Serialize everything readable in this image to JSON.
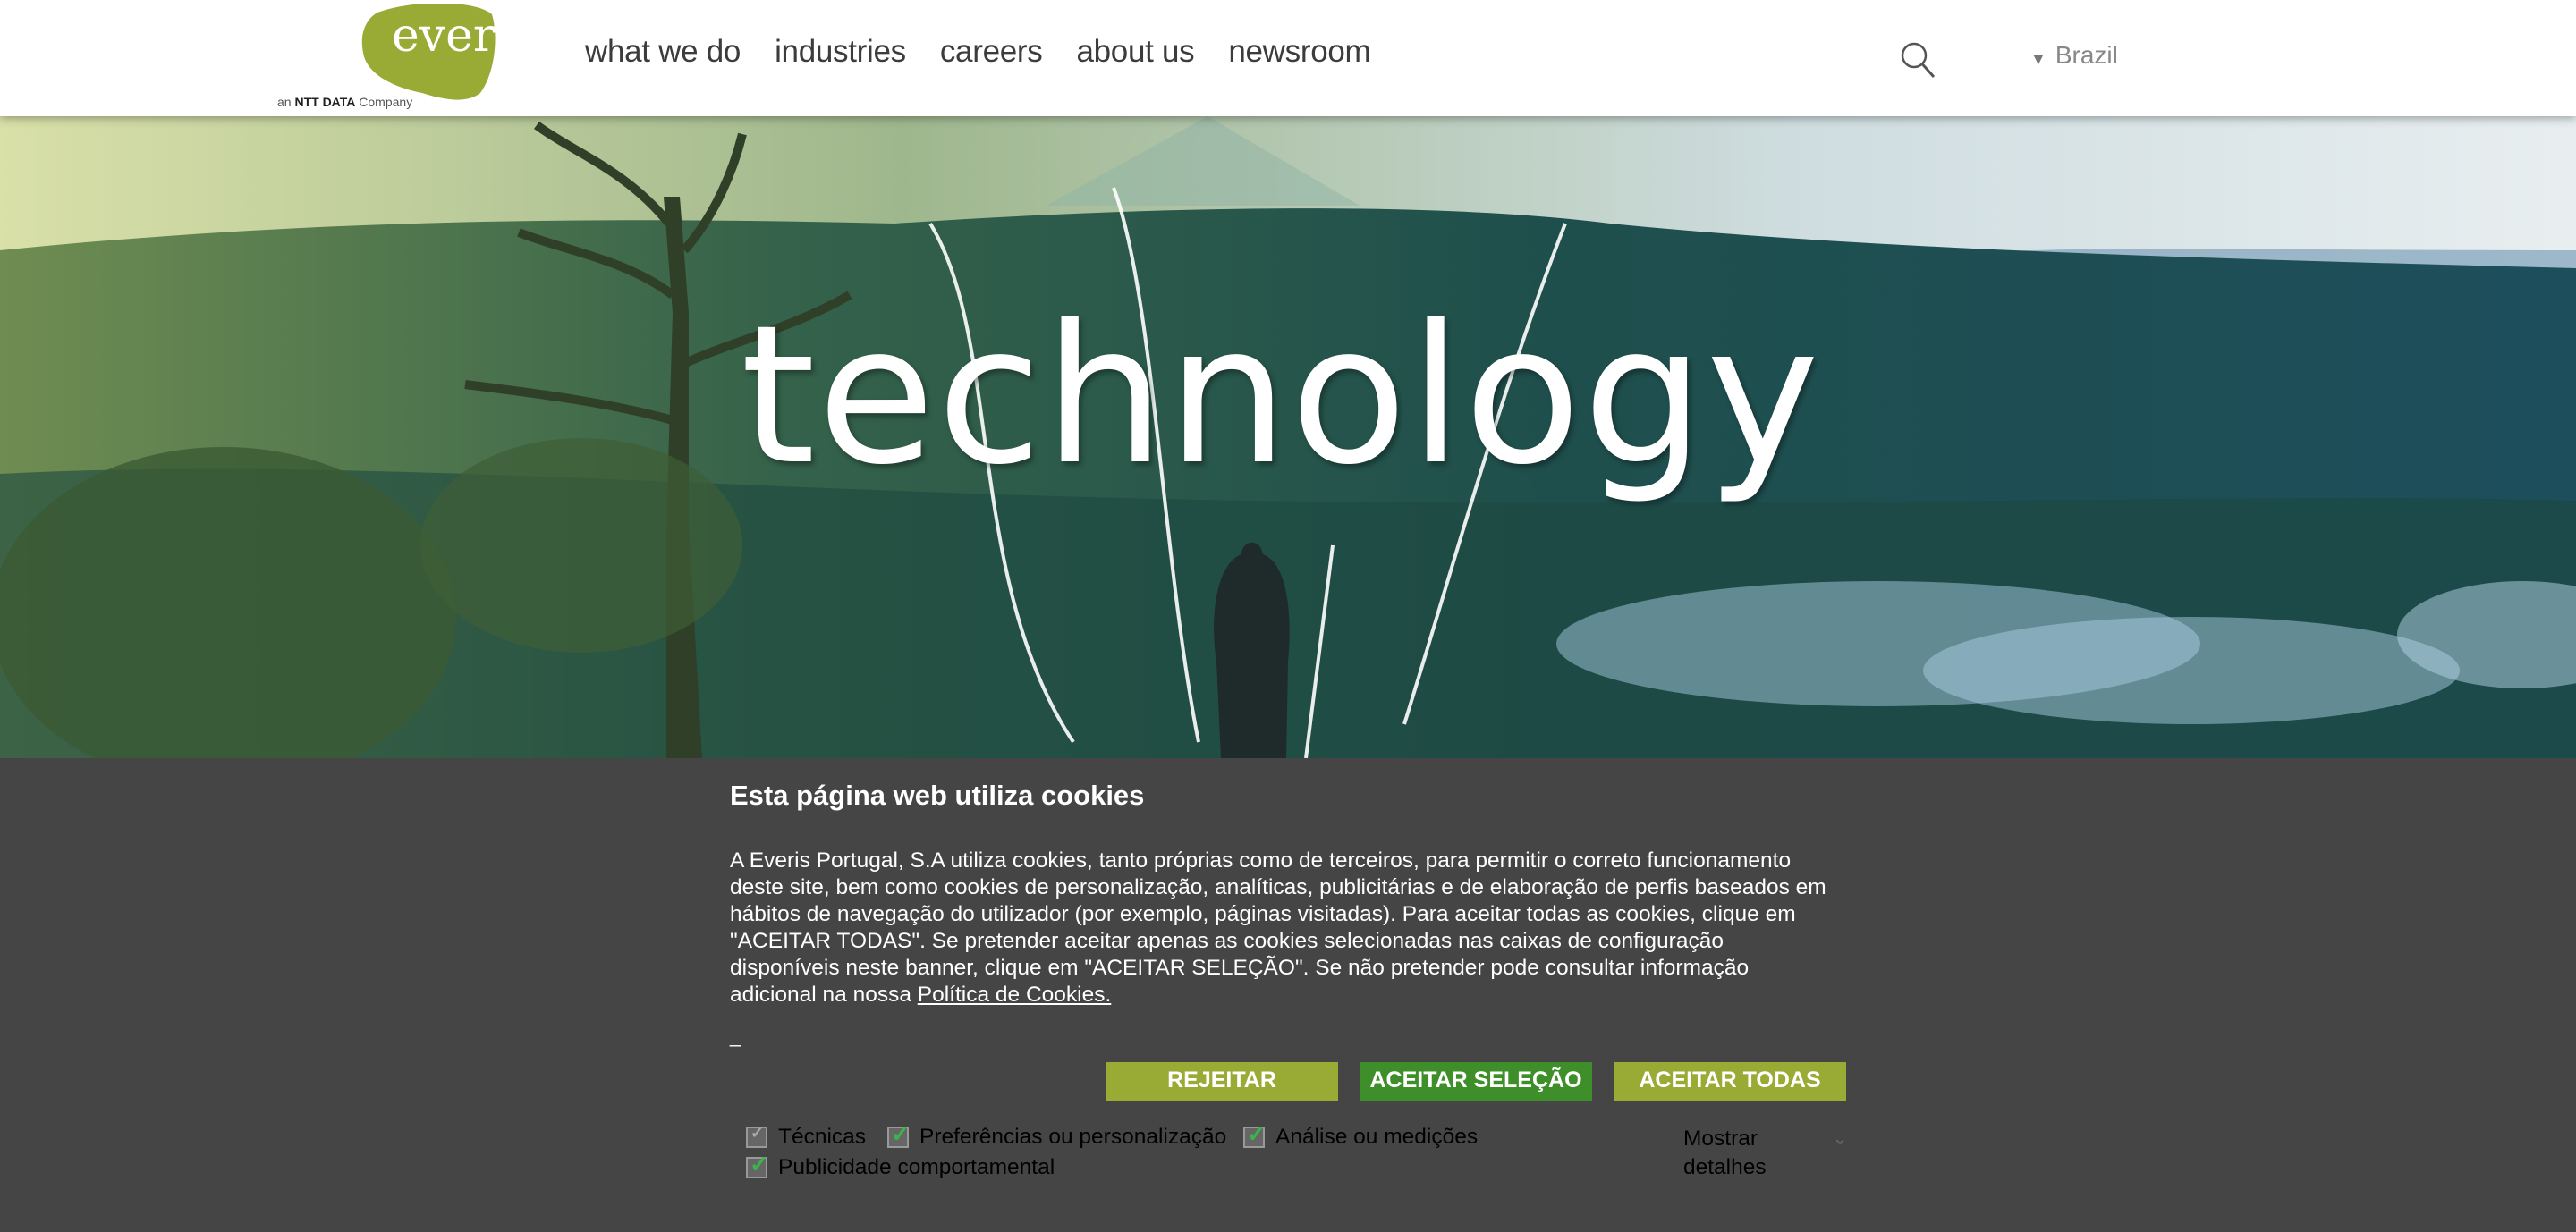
{
  "brand": {
    "logo_text": "everis",
    "tagline_prefix": "an",
    "tagline_brand": "NTT DATA",
    "tagline_suffix": "Company",
    "color": "#9aab35"
  },
  "nav": {
    "items": [
      "what we do",
      "industries",
      "careers",
      "about us",
      "newsroom"
    ]
  },
  "search": {
    "icon": "search-icon"
  },
  "country": {
    "label": "Brazil",
    "caret_icon": "triangle-down-icon"
  },
  "hero": {
    "title": "technology"
  },
  "cookie_banner": {
    "title": "Esta página web utiliza cookies",
    "body": "A Everis Portugal, S.A utiliza cookies, tanto próprias como de terceiros, para permitir o correto funcionamento deste site, bem como cookies de personalização, analíticas, publicitárias e de elaboração de perfis baseados em hábitos de navegação do utilizador (por exemplo, páginas visitadas). Para aceitar todas as cookies, clique em \"ACEITAR TODAS\". Se pretender aceitar apenas as cookies selecionadas nas caixas de configuração disponíveis neste banner, clique em \"ACEITAR SELEÇÃO\". Se não pretender pode consultar informação adicional na nossa",
    "policy_link": "Política de Cookies. ",
    "mark": "_",
    "buttons": {
      "reject": "REJEITAR",
      "accept_selection": "ACEITAR SELEÇÃO",
      "accept_all": "ACEITAR TODAS"
    },
    "options": [
      {
        "label": "Técnicas",
        "checked": false
      },
      {
        "label": "Preferências ou personalização",
        "checked": true
      },
      {
        "label": "Análise ou medições",
        "checked": true
      },
      {
        "label": "Publicidade comportamental",
        "checked": true
      }
    ],
    "show_details": "Mostrar detalhes",
    "colors": {
      "background": "#454545",
      "button_primary": "#9aab35",
      "button_selection": "#3e8f2a",
      "check": "#39b54a"
    }
  }
}
